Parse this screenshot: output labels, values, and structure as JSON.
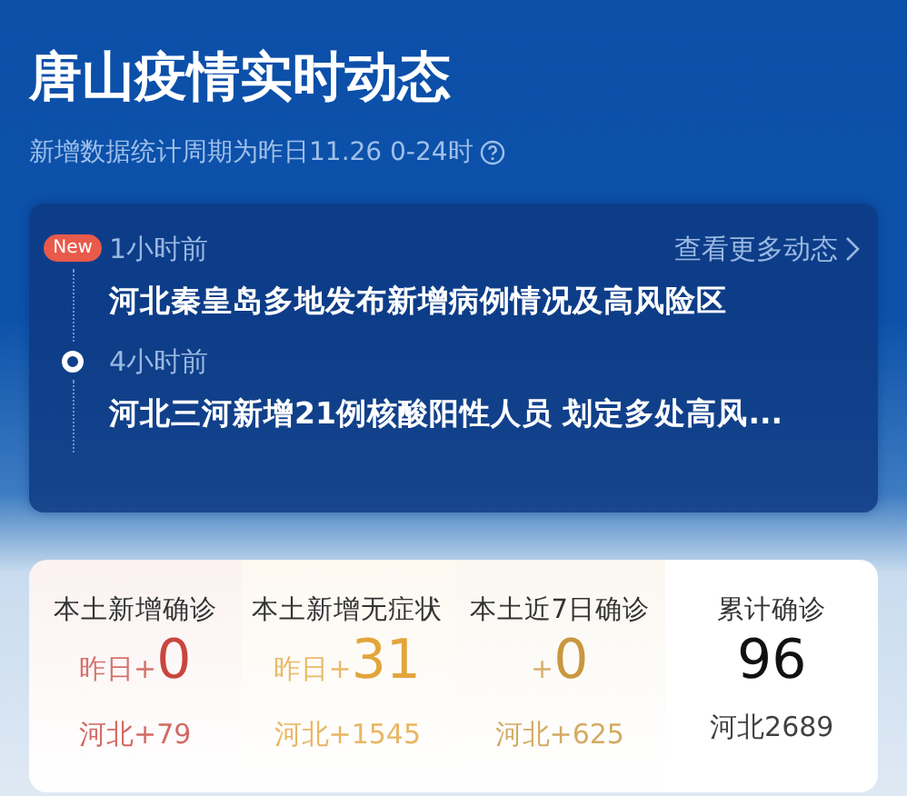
{
  "header": {
    "title": "唐山疫情实时动态",
    "subtitle": "新增数据统计周期为昨日11.26 0-24时"
  },
  "feed": {
    "more_link": "查看更多动态",
    "items": [
      {
        "kind": "new",
        "badge": "New",
        "time": "1小时前",
        "headline": "河北秦皇岛多地发布新增病例情况及高风险区"
      },
      {
        "kind": "dot",
        "time": "4小时前",
        "headline": "河北三河新增21例核酸阳性人员 划定多处高风..."
      }
    ]
  },
  "stats": [
    {
      "label": "本土新增确诊",
      "prefix": "昨日+",
      "value": "0",
      "sub": "河北+79",
      "color": "#c8463f"
    },
    {
      "label": "本土新增无症状",
      "prefix": "昨日+",
      "value": "31",
      "sub": "河北+1545",
      "color": "#e3a53c"
    },
    {
      "label": "本土近7日确诊",
      "prefix": "+",
      "value": "0",
      "sub": "河北+625",
      "color": "#c9973f"
    },
    {
      "label": "累计确诊",
      "value": "96",
      "sub": "河北2689",
      "color": "#111111"
    }
  ]
}
